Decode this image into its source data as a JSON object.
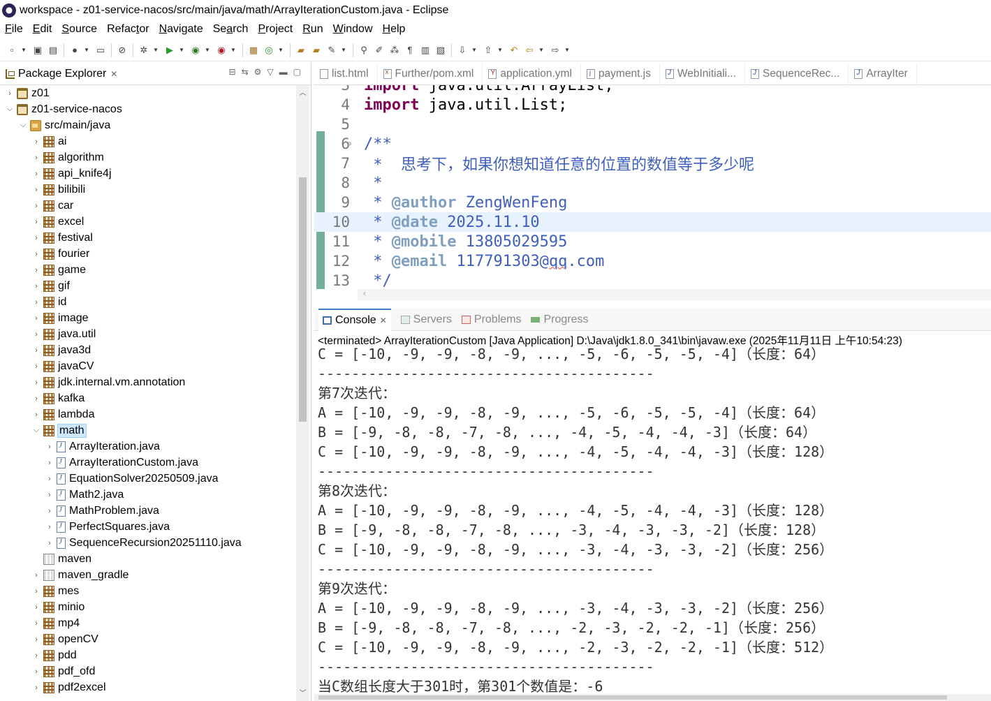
{
  "window": {
    "title": "workspace - z01-service-nacos/src/main/java/math/ArrayIterationCustom.java - Eclipse"
  },
  "menu": [
    {
      "mn": "F",
      "rest": "ile"
    },
    {
      "mn": "E",
      "rest": "dit"
    },
    {
      "mn": "S",
      "rest": "ource"
    },
    {
      "mn": "",
      "rest": "Refac",
      "mn2": "t",
      "rest2": "or"
    },
    {
      "mn": "N",
      "rest": "avigate"
    },
    {
      "mn": "",
      "rest": "Se",
      "mn2": "a",
      "rest2": "rch"
    },
    {
      "mn": "P",
      "rest": "roject"
    },
    {
      "mn": "R",
      "rest": "un"
    },
    {
      "mn": "W",
      "rest": "indow"
    },
    {
      "mn": "H",
      "rest": "elp"
    }
  ],
  "explorer": {
    "title": "Package Explorer",
    "tree": [
      {
        "label": "z01",
        "icon": "project",
        "level": 0,
        "twisty": "›"
      },
      {
        "label": "z01-service-nacos",
        "icon": "project",
        "level": 0,
        "twisty": "⌄"
      },
      {
        "label": "src/main/java",
        "icon": "srcfolder",
        "level": 1,
        "twisty": "⌄"
      },
      {
        "label": "ai",
        "icon": "pkg",
        "level": 2,
        "twisty": "›"
      },
      {
        "label": "algorithm",
        "icon": "pkg",
        "level": 2,
        "twisty": "›"
      },
      {
        "label": "api_knife4j",
        "icon": "pkg",
        "level": 2,
        "twisty": "›"
      },
      {
        "label": "bilibili",
        "icon": "pkg",
        "level": 2,
        "twisty": "›"
      },
      {
        "label": "car",
        "icon": "pkg",
        "level": 2,
        "twisty": "›"
      },
      {
        "label": "excel",
        "icon": "pkg",
        "level": 2,
        "twisty": "›"
      },
      {
        "label": "festival",
        "icon": "pkg",
        "level": 2,
        "twisty": "›"
      },
      {
        "label": "fourier",
        "icon": "pkg",
        "level": 2,
        "twisty": "›"
      },
      {
        "label": "game",
        "icon": "pkg",
        "level": 2,
        "twisty": "›"
      },
      {
        "label": "gif",
        "icon": "pkg",
        "level": 2,
        "twisty": "›"
      },
      {
        "label": "id",
        "icon": "pkg",
        "level": 2,
        "twisty": "›"
      },
      {
        "label": "image",
        "icon": "pkg",
        "level": 2,
        "twisty": "›"
      },
      {
        "label": "java.util",
        "icon": "pkg",
        "level": 2,
        "twisty": "›"
      },
      {
        "label": "java3d",
        "icon": "pkg",
        "level": 2,
        "twisty": "›"
      },
      {
        "label": "javaCV",
        "icon": "pkg",
        "level": 2,
        "twisty": "›"
      },
      {
        "label": "jdk.internal.vm.annotation",
        "icon": "pkg",
        "level": 2,
        "twisty": "›"
      },
      {
        "label": "kafka",
        "icon": "pkg",
        "level": 2,
        "twisty": "›"
      },
      {
        "label": "lambda",
        "icon": "pkg",
        "level": 2,
        "twisty": "›"
      },
      {
        "label": "math",
        "icon": "pkg",
        "level": 2,
        "twisty": "⌄",
        "selected": true
      },
      {
        "label": "ArrayIteration.java",
        "icon": "java",
        "level": 3,
        "twisty": "›"
      },
      {
        "label": "ArrayIterationCustom.java",
        "icon": "java",
        "level": 3,
        "twisty": "›"
      },
      {
        "label": "EquationSolver20250509.java",
        "icon": "java",
        "level": 3,
        "twisty": "›"
      },
      {
        "label": "Math2.java",
        "icon": "java",
        "level": 3,
        "twisty": "›"
      },
      {
        "label": "MathProblem.java",
        "icon": "java",
        "level": 3,
        "twisty": "›"
      },
      {
        "label": "PerfectSquares.java",
        "icon": "java",
        "level": 3,
        "twisty": "›"
      },
      {
        "label": "SequenceRecursion20251110.java",
        "icon": "java",
        "level": 3,
        "twisty": "›"
      },
      {
        "label": "maven",
        "icon": "pkg-empty",
        "level": 2,
        "twisty": ""
      },
      {
        "label": "maven_gradle",
        "icon": "pkg-empty",
        "level": 2,
        "twisty": "›"
      },
      {
        "label": "mes",
        "icon": "pkg",
        "level": 2,
        "twisty": "›"
      },
      {
        "label": "minio",
        "icon": "pkg",
        "level": 2,
        "twisty": "›"
      },
      {
        "label": "mp4",
        "icon": "pkg",
        "level": 2,
        "twisty": "›"
      },
      {
        "label": "openCV",
        "icon": "pkg",
        "level": 2,
        "twisty": "›"
      },
      {
        "label": "pdd",
        "icon": "pkg",
        "level": 2,
        "twisty": "›"
      },
      {
        "label": "pdf_ofd",
        "icon": "pkg",
        "level": 2,
        "twisty": "›"
      },
      {
        "label": "pdf2excel",
        "icon": "pkg",
        "level": 2,
        "twisty": "›"
      }
    ]
  },
  "editor": {
    "tabs": [
      {
        "label": "list.html",
        "type": "html"
      },
      {
        "label": "Further/pom.xml",
        "type": "xml"
      },
      {
        "label": "application.yml",
        "type": "yml"
      },
      {
        "label": "payment.js",
        "type": "js"
      },
      {
        "label": "WebInitiali...",
        "type": "java"
      },
      {
        "label": "SequenceRec...",
        "type": "java"
      },
      {
        "label": "ArrayIter",
        "type": "java"
      }
    ],
    "lines": [
      {
        "num": "3",
        "kw": "import",
        "text": " java.util.ArrayList;",
        "partial": true
      },
      {
        "num": "4",
        "kw": "import",
        "text": " java.util.List;"
      },
      {
        "num": "5",
        "text": ""
      },
      {
        "num": "6",
        "fold": "⊖",
        "text": "/**",
        "cls": "cm"
      },
      {
        "num": "7",
        "text": " *  思考下，如果你想知道任意的位置的数值等于多少呢",
        "cls": "cm"
      },
      {
        "num": "8",
        "text": " *",
        "cls": "cm"
      },
      {
        "num": "9",
        "pre": " * ",
        "tag": "@author",
        "rest": " ZengWenFeng"
      },
      {
        "num": "10",
        "pre": " * ",
        "tag": "@date",
        "rest": " 2025.11.10",
        "hl": true
      },
      {
        "num": "11",
        "pre": " * ",
        "tag": "@mobile",
        "rest": " 13805029595"
      },
      {
        "num": "12",
        "pre": " * ",
        "tag": "@email",
        "rest": " 117791303@",
        "squig": "qq",
        "rest2": ".com"
      },
      {
        "num": "13",
        "text": " */",
        "cls": "cm"
      }
    ]
  },
  "console": {
    "tabs": [
      {
        "label": "Console",
        "active": true,
        "icon": "console"
      },
      {
        "label": "Servers",
        "icon": "servers"
      },
      {
        "label": "Problems",
        "icon": "problems"
      },
      {
        "label": "Progress",
        "icon": "progress"
      }
    ],
    "status": "<terminated> ArrayIterationCustom [Java Application] D:\\Java\\jdk1.8.0_341\\bin\\javaw.exe (2025年11月11日 上午10:54:23)",
    "output": [
      "C = [-10, -9, -9, -8, -9, ..., -5, -6, -5, -5, -4]（长度：64）",
      "----------------------------------------",
      "第7次迭代：",
      "A = [-10, -9, -9, -8, -9, ..., -5, -6, -5, -5, -4]（长度：64）",
      "B = [-9, -8, -8, -7, -8, ..., -4, -5, -4, -4, -3]（长度：64）",
      "C = [-10, -9, -9, -8, -9, ..., -4, -5, -4, -4, -3]（长度：128）",
      "----------------------------------------",
      "第8次迭代：",
      "A = [-10, -9, -9, -8, -9, ..., -4, -5, -4, -4, -3]（长度：128）",
      "B = [-9, -8, -8, -7, -8, ..., -3, -4, -3, -3, -2]（长度：128）",
      "C = [-10, -9, -9, -8, -9, ..., -3, -4, -3, -3, -2]（长度：256）",
      "----------------------------------------",
      "第9次迭代：",
      "A = [-10, -9, -9, -8, -9, ..., -3, -4, -3, -3, -2]（长度：256）",
      "B = [-9, -8, -8, -7, -8, ..., -2, -3, -2, -2, -1]（长度：256）",
      "C = [-10, -9, -9, -8, -9, ..., -2, -3, -2, -2, -1]（长度：512）",
      "----------------------------------------",
      "当C数组长度大于301时，第301个数值是：-6"
    ]
  }
}
